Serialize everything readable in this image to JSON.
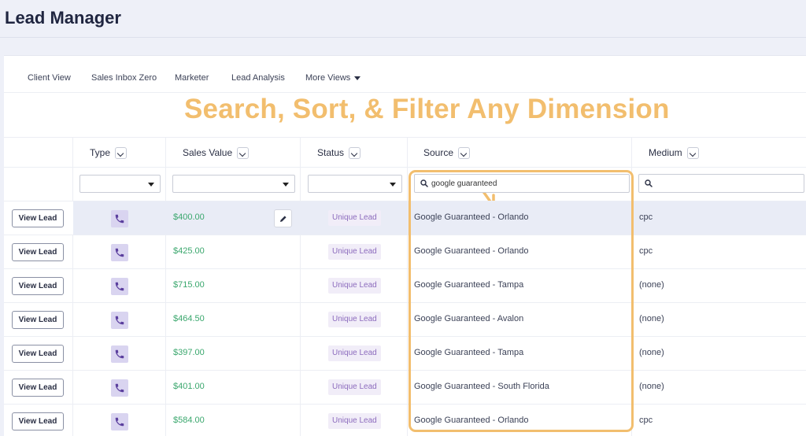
{
  "page": {
    "title": "Lead Manager"
  },
  "tabs": [
    {
      "label": "Client View"
    },
    {
      "label": "Sales Inbox Zero"
    },
    {
      "label": "Marketer"
    },
    {
      "label": "Lead Analysis"
    },
    {
      "label": "More Views",
      "has_dropdown": true
    }
  ],
  "annotation": {
    "text": "Search, Sort, & Filter Any Dimension",
    "color": "#f2be6e"
  },
  "columns": [
    {
      "label": "Type"
    },
    {
      "label": "Sales Value"
    },
    {
      "label": "Status"
    },
    {
      "label": "Source"
    },
    {
      "label": "Medium"
    }
  ],
  "filters": {
    "type": "",
    "sales_value": "",
    "status": "",
    "source_search": "google guaranteed",
    "medium_search": ""
  },
  "row_action_label": "View Lead",
  "rows": [
    {
      "type_icon": "phone-icon",
      "sales_value": "$400.00",
      "status": "Unique Lead",
      "source": "Google Guaranteed - Orlando",
      "medium": "cpc",
      "selected": true
    },
    {
      "type_icon": "phone-icon",
      "sales_value": "$425.00",
      "status": "Unique Lead",
      "source": "Google Guaranteed - Orlando",
      "medium": "cpc"
    },
    {
      "type_icon": "phone-icon",
      "sales_value": "$715.00",
      "status": "Unique Lead",
      "source": "Google Guaranteed - Tampa",
      "medium": "(none)"
    },
    {
      "type_icon": "phone-icon",
      "sales_value": "$464.50",
      "status": "Unique Lead",
      "source": "Google Guaranteed - Avalon",
      "medium": "(none)"
    },
    {
      "type_icon": "phone-icon",
      "sales_value": "$397.00",
      "status": "Unique Lead",
      "source": "Google Guaranteed - Tampa",
      "medium": "(none)"
    },
    {
      "type_icon": "phone-icon",
      "sales_value": "$401.00",
      "status": "Unique Lead",
      "source": "Google Guaranteed - South Florida",
      "medium": "(none)"
    },
    {
      "type_icon": "phone-icon",
      "sales_value": "$584.00",
      "status": "Unique Lead",
      "source": "Google Guaranteed - Orlando",
      "medium": "cpc"
    }
  ],
  "colors": {
    "accent": "#f2be6e",
    "value_green": "#3aa76d",
    "badge_purple": "#8c6bbd",
    "selected_row": "#e9ecf6"
  }
}
